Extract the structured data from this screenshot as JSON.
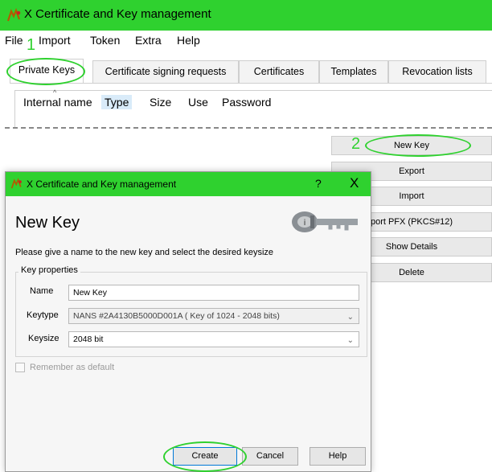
{
  "window": {
    "title": "X Certificate and Key management"
  },
  "menu": [
    "File",
    "Import",
    "Token",
    "Extra",
    "Help"
  ],
  "tabs": [
    "Private Keys",
    "Certificate signing requests",
    "Certificates",
    "Templates",
    "Revocation lists"
  ],
  "active_tab": "Private Keys",
  "table": {
    "columns": [
      "Internal name",
      "Type",
      "Size",
      "Use",
      "Password"
    ]
  },
  "side_buttons": [
    "New Key",
    "Export",
    "Import",
    "port PFX (PKCS#12)",
    "Show Details",
    "Delete"
  ],
  "annotations": [
    "1",
    "2"
  ],
  "dialog": {
    "title": "X Certificate and Key management",
    "help_glyph": "?",
    "close_glyph": "X",
    "heading": "New Key",
    "description": "Please give a name to the new key and select the desired keysize",
    "group_title": "Key properties",
    "fields": {
      "name": {
        "label": "Name",
        "value": "New Key"
      },
      "keytype": {
        "label": "Keytype",
        "value": "NANS #2A4130B5000D001A ( Key of 1024 - 2048 bits)"
      },
      "keysize": {
        "label": "Keysize",
        "value": "2048 bit"
      }
    },
    "remember_label": "Remember as default",
    "buttons": {
      "create": "Create",
      "cancel": "Cancel",
      "help": "Help"
    }
  },
  "colors": {
    "titlebar": "#2fd12f",
    "annotation": "#2fd12f",
    "selected_header": "#d9ebf9"
  },
  "icons": [
    "app-icon",
    "key-icon",
    "chevron-down-icon",
    "caret-up-icon"
  ]
}
